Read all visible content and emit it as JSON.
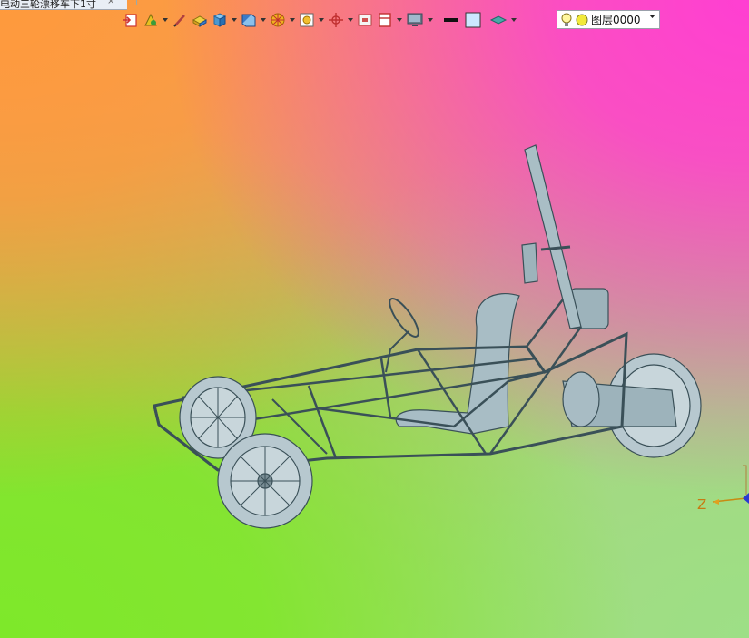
{
  "window": {
    "tab_title": "电动三轮漂移车下1寸",
    "tab_close": "×"
  },
  "toolbar": {
    "icons": [
      "import-icon",
      "select-filter-icon",
      "pen-icon",
      "box-icon",
      "solid-cube-icon",
      "view-orient-icon",
      "wheel-icon",
      "zoom-fit-icon",
      "move-icon",
      "frame-icon",
      "section-icon",
      "display-monitor-icon",
      "line-color-icon",
      "fill-color-icon",
      "layer-plane-icon",
      "lightbulb-icon",
      "layer-color-icon"
    ],
    "layer_name": "图层0000",
    "colors": {
      "line": "#111111",
      "fill": "#cce8ff",
      "layer_dot": "#f2e93a"
    }
  },
  "viewport": {
    "axis_label": "Z",
    "model_color": "#9db3bb"
  }
}
